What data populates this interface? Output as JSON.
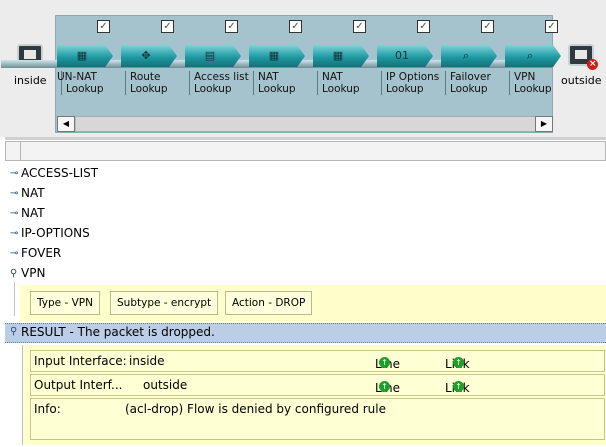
{
  "packet_tracer": {
    "source_label": "inside",
    "destination_label": "outside",
    "stages": [
      {
        "label": "UN-NAT\nLookup",
        "icon": "wall-icon",
        "glyph": "▦",
        "checked": true
      },
      {
        "label": "Route\nLookup",
        "icon": "router-icon",
        "glyph": "✥",
        "checked": true
      },
      {
        "label": "Access list\nLookup",
        "icon": "access-list-icon",
        "glyph": "▤",
        "checked": true
      },
      {
        "label": "NAT\nLookup",
        "icon": "wall-icon",
        "glyph": "▦",
        "checked": true
      },
      {
        "label": "NAT\nLookup",
        "icon": "wall-icon",
        "glyph": "▦",
        "checked": true
      },
      {
        "label": "IP Options\nLookup",
        "icon": "ip-options-icon",
        "glyph": "01",
        "checked": true
      },
      {
        "label": "Failover\nLookup",
        "icon": "magnifier-icon",
        "glyph": "⌕",
        "checked": true
      },
      {
        "label": "VPN\nLookup",
        "icon": "magnifier-icon",
        "glyph": "⌕",
        "checked": true
      }
    ],
    "check_glyph": "✓",
    "scroll_left": "◀",
    "scroll_right": "▶"
  },
  "tree": {
    "nodes": [
      {
        "label": "ACCESS-LIST",
        "expanded": false
      },
      {
        "label": "NAT",
        "expanded": false
      },
      {
        "label": "NAT",
        "expanded": false
      },
      {
        "label": "IP-OPTIONS",
        "expanded": false
      },
      {
        "label": "FOVER",
        "expanded": false
      },
      {
        "label": "VPN",
        "expanded": true
      }
    ],
    "collapsed_glyph": "⊸",
    "expanded_glyph": "⚲",
    "vpn_details": {
      "type": "Type -  VPN",
      "subtype": "Subtype -  encrypt",
      "action": "Action -  DROP"
    },
    "result": {
      "label": "RESULT - The packet is dropped.",
      "input_interface_label": "Input Interface:",
      "input_interface_value": "inside",
      "output_interface_label": "Output Interf...",
      "output_interface_value": "outside",
      "line_label": "Line",
      "link_label": "Link",
      "up_glyph": "↑",
      "info_label": "Info:",
      "info_value": "(acl-drop) Flow is denied by configured rule"
    }
  },
  "colors": {
    "pipeline_bg": "#a5c3cc",
    "stage_teal": "#1f9aa2",
    "detail_bg": "#ffffcc",
    "result_bg": "#bccde6",
    "status_up": "#1ea028",
    "drop_red": "#d21c1c"
  }
}
